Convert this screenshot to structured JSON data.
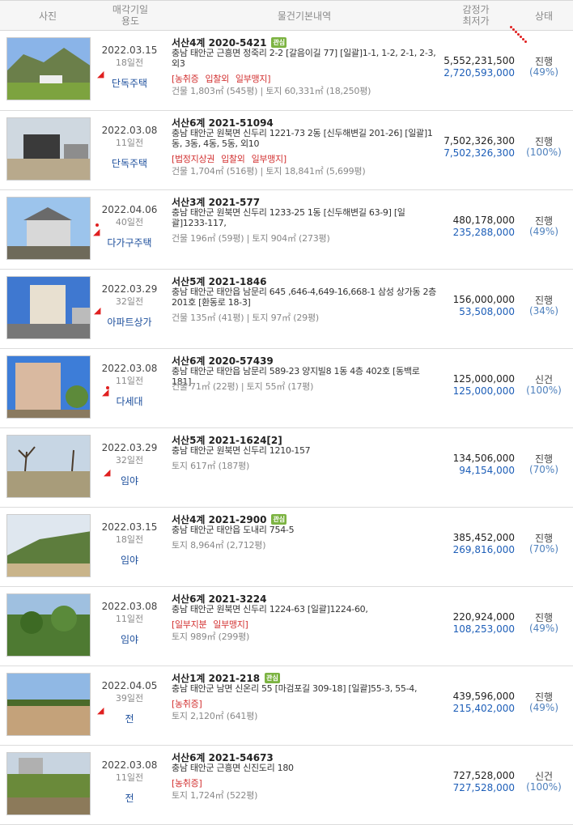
{
  "header": {
    "photo": "사진",
    "date_usage": "매각기일\n용도",
    "info": "물건기본내역",
    "price": "감정가\n최저가",
    "status": "상태"
  },
  "items": [
    {
      "date": "2022.03.15",
      "ago": "18일전",
      "usage": "단독주택",
      "case_no": "서산4계 2020-5421",
      "badge": "관심",
      "address": "충남 태안군 근흥면 정죽리 2-2 [갈음이길 77] [일괄]1-1, 1-2, 2-1, 2-3, 외3",
      "tags": [
        "[농취증",
        "입찰외",
        "일부맹지]"
      ],
      "area": "건물 1,803㎡ (545평)  |  토지 60,331㎡ (18,250평)",
      "appraisal": "5,552,231,500",
      "minimum": "2,720,593,000",
      "status": "진행",
      "percent": "(49%)"
    },
    {
      "date": "2022.03.08",
      "ago": "11일전",
      "usage": "단독주택",
      "case_no": "서산6계 2021-51094",
      "badge": "",
      "address": "충남 태안군 원북면 신두리 1221-73 2동 [신두해변길 201-26] [일괄]1동, 3동, 4동, 5동, 외10",
      "tags": [
        "[법정지상권",
        "입찰외",
        "일부맹지]"
      ],
      "area": "건물 1,704㎡ (516평)  |  토지 18,841㎡ (5,699평)",
      "appraisal": "7,502,326,300",
      "minimum": "7,502,326,300",
      "status": "진행",
      "percent": "(100%)"
    },
    {
      "date": "2022.04.06",
      "ago": "40일전",
      "usage": "다가구주택",
      "case_no": "서산3계 2021-577",
      "badge": "",
      "address": "충남 태안군 원북면 신두리 1233-25 1동 [신두해변길 63-9] [일괄]1233-117,",
      "tags": [],
      "area": "건물 196㎡ (59평)  |  토지 904㎡ (273평)",
      "appraisal": "480,178,000",
      "minimum": "235,288,000",
      "status": "진행",
      "percent": "(49%)"
    },
    {
      "date": "2022.03.29",
      "ago": "32일전",
      "usage": "아파트상가",
      "case_no": "서산5계 2021-1846",
      "badge": "",
      "address": "충남 태안군 태안읍 남문리 645 ,646-4,649-16,668-1 삼성 상가동 2층 201호 [환동로 18-3]",
      "tags": [],
      "area": "건물 135㎡ (41평)  |  토지 97㎡ (29평)",
      "appraisal": "156,000,000",
      "minimum": "53,508,000",
      "status": "진행",
      "percent": "(34%)"
    },
    {
      "date": "2022.03.08",
      "ago": "11일전",
      "usage": "다세대",
      "case_no": "서산6계 2020-57439",
      "badge": "",
      "address": "충남 태안군 태안읍 남문리 589-23 양지빌8 1동 4층 402호 [동백로 181]",
      "tags": [],
      "area": "건물 71㎡ (22평)  |  토지 55㎡ (17평)",
      "appraisal": "125,000,000",
      "minimum": "125,000,000",
      "status": "신건",
      "percent": "(100%)"
    },
    {
      "date": "2022.03.29",
      "ago": "32일전",
      "usage": "임야",
      "case_no": "서산5계 2021-1624[2]",
      "badge": "",
      "address": "충남 태안군 원북면 신두리 1210-157",
      "tags": [],
      "area": "토지 617㎡ (187평)",
      "appraisal": "134,506,000",
      "minimum": "94,154,000",
      "status": "진행",
      "percent": "(70%)"
    },
    {
      "date": "2022.03.15",
      "ago": "18일전",
      "usage": "임야",
      "case_no": "서산4계 2021-2900",
      "badge": "관심",
      "address": "충남 태안군 태안읍 도내리 754-5",
      "tags": [],
      "area": "토지 8,964㎡ (2,712평)",
      "appraisal": "385,452,000",
      "minimum": "269,816,000",
      "status": "진행",
      "percent": "(70%)"
    },
    {
      "date": "2022.03.08",
      "ago": "11일전",
      "usage": "임야",
      "case_no": "서산6계 2021-3224",
      "badge": "",
      "address": "충남 태안군 원북면 신두리 1224-63 [일괄]1224-60,",
      "tags": [
        "[일부지분",
        "일부맹지]"
      ],
      "area": "토지 989㎡ (299평)",
      "appraisal": "220,924,000",
      "minimum": "108,253,000",
      "status": "진행",
      "percent": "(49%)"
    },
    {
      "date": "2022.04.05",
      "ago": "39일전",
      "usage": "전",
      "case_no": "서산1계 2021-218",
      "badge": "관심",
      "address": "충남 태안군 남면 신온리 55 [마검포길 309-18] [일괄]55-3, 55-4,",
      "tags": [
        "[농취증]"
      ],
      "area": "토지 2,120㎡ (641평)",
      "appraisal": "439,596,000",
      "minimum": "215,402,000",
      "status": "진행",
      "percent": "(49%)"
    },
    {
      "date": "2022.03.08",
      "ago": "11일전",
      "usage": "전",
      "case_no": "서산6계 2021-54673",
      "badge": "",
      "address": "충남 태안군 근흥면 신진도리 180",
      "tags": [
        "[농취증]"
      ],
      "area": "토지 1,724㎡ (522평)",
      "appraisal": "727,528,000",
      "minimum": "727,528,000",
      "status": "신건",
      "percent": "(100%)"
    }
  ]
}
